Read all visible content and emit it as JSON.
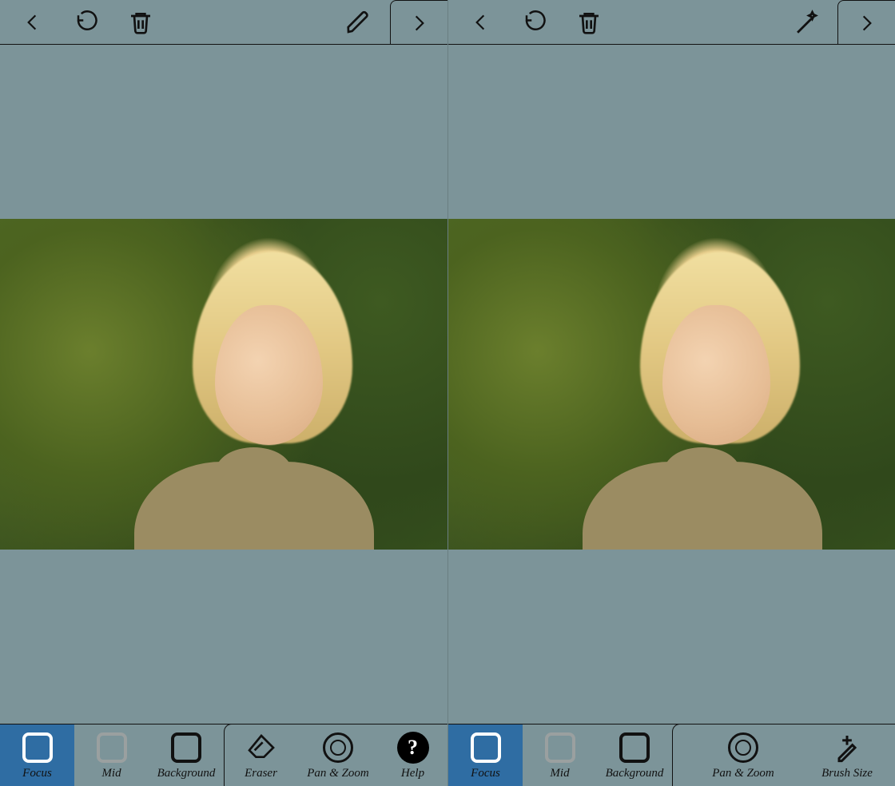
{
  "panes": [
    {
      "top": {
        "mode_icon": "pencil"
      },
      "tools_left": [
        {
          "name": "focus",
          "label": "Focus",
          "swatch": "white",
          "selected": true
        },
        {
          "name": "mid",
          "label": "Mid",
          "swatch": "grey",
          "selected": false
        },
        {
          "name": "background",
          "label": "Background",
          "swatch": "black",
          "selected": false
        }
      ],
      "tools_right": [
        {
          "name": "eraser",
          "label": "Eraser",
          "icon": "eraser"
        },
        {
          "name": "panzoom",
          "label": "Pan & Zoom",
          "icon": "ring"
        },
        {
          "name": "help",
          "label": "Help",
          "icon": "help"
        }
      ]
    },
    {
      "top": {
        "mode_icon": "wand"
      },
      "tools_left": [
        {
          "name": "focus",
          "label": "Focus",
          "swatch": "white",
          "selected": true
        },
        {
          "name": "mid",
          "label": "Mid",
          "swatch": "grey",
          "selected": false
        },
        {
          "name": "background",
          "label": "Background",
          "swatch": "black",
          "selected": false
        }
      ],
      "tools_right": [
        {
          "name": "panzoom",
          "label": "Pan & Zoom",
          "icon": "ring"
        },
        {
          "name": "brushsize",
          "label": "Brush Size",
          "icon": "brushsize"
        }
      ]
    }
  ]
}
